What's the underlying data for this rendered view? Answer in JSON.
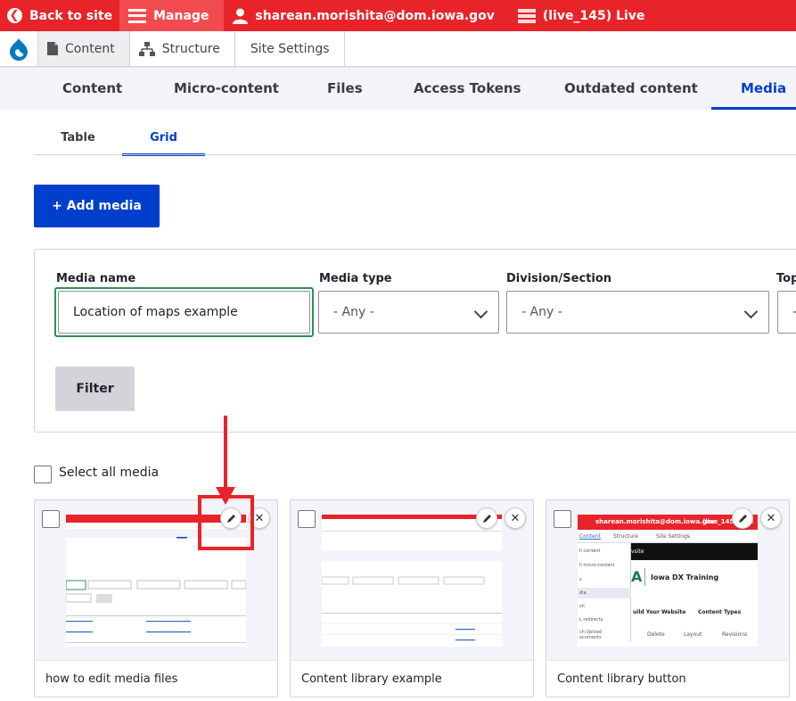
{
  "toolbar": {
    "back_label": "Back to site",
    "manage_label": "Manage",
    "user_label": "sharean.morishita@dom.iowa.gov",
    "environment_label": "(live_145) Live"
  },
  "tray": {
    "items": [
      {
        "label": "Content"
      },
      {
        "label": "Structure"
      },
      {
        "label": "Site Settings"
      }
    ]
  },
  "primary_tabs": [
    {
      "label": "Content"
    },
    {
      "label": "Micro-content"
    },
    {
      "label": "Files"
    },
    {
      "label": "Access Tokens"
    },
    {
      "label": "Outdated content"
    },
    {
      "label": "Media",
      "active": true
    }
  ],
  "secondary_tabs": [
    {
      "label": "Table"
    },
    {
      "label": "Grid",
      "active": true
    }
  ],
  "add_media_label": "+ Add media",
  "filters": {
    "media_name": {
      "label": "Media name",
      "value": "Location of maps example"
    },
    "media_type": {
      "label": "Media type",
      "value": "- Any -"
    },
    "division": {
      "label": "Division/Section",
      "value": "- Any -"
    },
    "topic": {
      "label": "Top",
      "value": "-"
    },
    "filter_button": "Filter"
  },
  "select_all_label": "Select all media",
  "cards": [
    {
      "title": "how to edit media files"
    },
    {
      "title": "Content library example"
    },
    {
      "title": "Content library button"
    }
  ],
  "thumb3": {
    "user": "sharean.morishita@dom.iowa.gov",
    "env": "(live_145) Live",
    "content": "Content",
    "structure": "Structure",
    "settings": "Site Settings",
    "site_name": "Iowa DX Training",
    "menu": [
      "ll content",
      "ll micro-content",
      "s",
      "dia",
      "sh",
      "L redirects",
      "ch Upload\nocuments"
    ],
    "build": "uild Your Website",
    "content_types": "Content Types",
    "actions": [
      "Delete",
      "Layout",
      "Revisions"
    ],
    "bar_label": "vsite"
  },
  "colors": {
    "toolbar_red": "#e8242a",
    "accent_blue": "#003ecc",
    "focus_green": "#2f8f55"
  }
}
